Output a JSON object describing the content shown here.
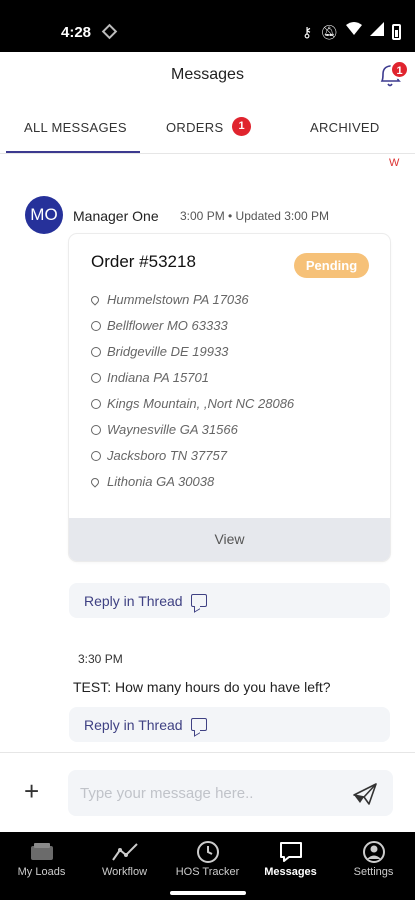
{
  "status_bar": {
    "time": "4:28"
  },
  "header": {
    "title": "Messages",
    "notification_count": "1"
  },
  "tabs": [
    {
      "label": "ALL MESSAGES",
      "active": true
    },
    {
      "label": "ORDERS",
      "badge": "1"
    },
    {
      "label": "ARCHIVED"
    }
  ],
  "corner_mark": "W",
  "thread": {
    "avatar_initials": "MO",
    "sender": "Manager One",
    "meta": "3:00 PM • Updated 3:00 PM",
    "order": {
      "title": "Order #53218",
      "status": "Pending",
      "status_color": "#f6c178",
      "stops": [
        {
          "label": "Hummelstown PA 17036",
          "icon": "pin-icon"
        },
        {
          "label": "Bellflower MO 63333",
          "icon": "circle-icon"
        },
        {
          "label": "Bridgeville DE 19933",
          "icon": "circle-icon"
        },
        {
          "label": "Indiana PA 15701",
          "icon": "circle-icon"
        },
        {
          "label": "Kings Mountain, ,Nort NC 28086",
          "icon": "circle-icon"
        },
        {
          "label": "Waynesville GA 31566",
          "icon": "circle-icon"
        },
        {
          "label": "Jacksboro TN 37757",
          "icon": "circle-icon"
        },
        {
          "label": "Lithonia GA 30038",
          "icon": "pin-icon"
        }
      ],
      "view_label": "View"
    },
    "reply_label": "Reply in Thread"
  },
  "message": {
    "time": "3:30 PM",
    "text": "TEST: How many hours do you have left?",
    "reply_label": "Reply in Thread"
  },
  "composer": {
    "placeholder": "Type your message here..",
    "add_icon": "plus-icon",
    "send_icon": "send-icon"
  },
  "bottom_nav": [
    {
      "label": "My Loads",
      "icon": "truck-icon"
    },
    {
      "label": "Workflow",
      "icon": "workflow-icon"
    },
    {
      "label": "HOS Tracker",
      "icon": "clock-icon"
    },
    {
      "label": "Messages",
      "icon": "chat-icon",
      "active": true
    },
    {
      "label": "Settings",
      "icon": "settings-icon"
    }
  ],
  "colors": {
    "accent": "#3c3a8f",
    "avatar": "#26319a",
    "badge": "#e0242e"
  }
}
